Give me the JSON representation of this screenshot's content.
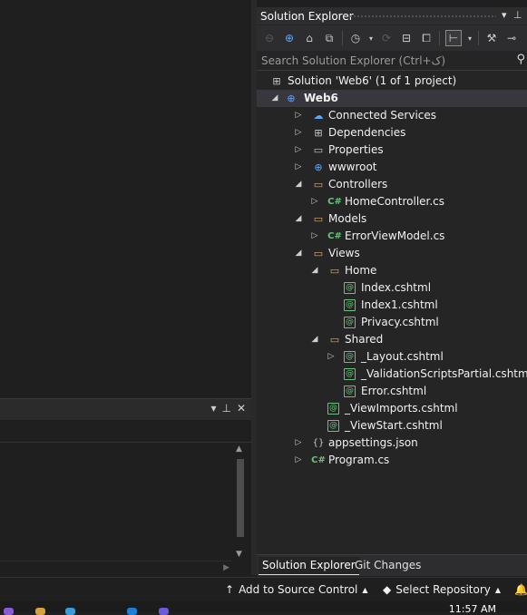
{
  "solution_explorer": {
    "title": "Solution Explorer",
    "search_placeholder": "Search Solution Explorer (Ctrl+ک)",
    "toolbar_icons": [
      "back-icon",
      "forward-icon",
      "home-icon",
      "vs-switch-icon",
      "history-icon",
      "dropdown-icon",
      "sync-icon",
      "collapse-all-icon",
      "show-all-files-icon",
      "preview-icon",
      "dropdown-icon",
      "wrench-icon",
      "pin-icon"
    ],
    "tree": [
      {
        "level": 0,
        "expand": "none",
        "icon": "solution",
        "label": "Solution 'Web6' (1 of 1 project)",
        "bold": false
      },
      {
        "level": 0,
        "expand": "open",
        "icon": "project",
        "label": "Web6",
        "bold": true
      },
      {
        "level": 1,
        "expand": "closed",
        "icon": "connected",
        "label": "Connected Services"
      },
      {
        "level": 1,
        "expand": "closed",
        "icon": "deps",
        "label": "Dependencies"
      },
      {
        "level": 1,
        "expand": "closed",
        "icon": "props",
        "label": "Properties"
      },
      {
        "level": 1,
        "expand": "closed",
        "icon": "globe",
        "label": "wwwroot"
      },
      {
        "level": 1,
        "expand": "open",
        "icon": "folder",
        "label": "Controllers"
      },
      {
        "level": 2,
        "expand": "closed",
        "icon": "cs",
        "label": "HomeController.cs"
      },
      {
        "level": 1,
        "expand": "open",
        "icon": "folder",
        "label": "Models"
      },
      {
        "level": 2,
        "expand": "closed",
        "icon": "cs",
        "label": "ErrorViewModel.cs"
      },
      {
        "level": 1,
        "expand": "open",
        "icon": "folder",
        "label": "Views"
      },
      {
        "level": 2,
        "expand": "open",
        "icon": "folder",
        "label": "Home"
      },
      {
        "level": 3,
        "expand": "none",
        "icon": "razor",
        "label": "Index.cshtml"
      },
      {
        "level": 3,
        "expand": "none",
        "icon": "razor",
        "label": "Index1.cshtml"
      },
      {
        "level": 3,
        "expand": "none",
        "icon": "razor",
        "label": "Privacy.cshtml"
      },
      {
        "level": 2,
        "expand": "open",
        "icon": "folder",
        "label": "Shared"
      },
      {
        "level": 3,
        "expand": "closed",
        "icon": "razor",
        "label": "_Layout.cshtml"
      },
      {
        "level": 3,
        "expand": "none",
        "icon": "razor",
        "label": "_ValidationScriptsPartial.cshtml"
      },
      {
        "level": 3,
        "expand": "none",
        "icon": "razor",
        "label": "Error.cshtml"
      },
      {
        "level": 2,
        "expand": "none",
        "icon": "razor",
        "label": "_ViewImports.cshtml"
      },
      {
        "level": 2,
        "expand": "none",
        "icon": "razor",
        "label": "_ViewStart.cshtml"
      },
      {
        "level": 1,
        "expand": "closed",
        "icon": "json",
        "label": "appsettings.json"
      },
      {
        "level": 1,
        "expand": "closed",
        "icon": "cs",
        "label": "Program.cs"
      }
    ],
    "tabs": [
      "Solution Explorer",
      "Git Changes"
    ]
  },
  "statusbar": {
    "add_source_control": "Add to Source Control",
    "select_repository": "Select Repository"
  },
  "taskbar": {
    "time": "11:57 AM"
  },
  "colors": {
    "accent": "#5aa7ff",
    "folder": "#d8ac6a",
    "csharp": "#68c27a"
  }
}
